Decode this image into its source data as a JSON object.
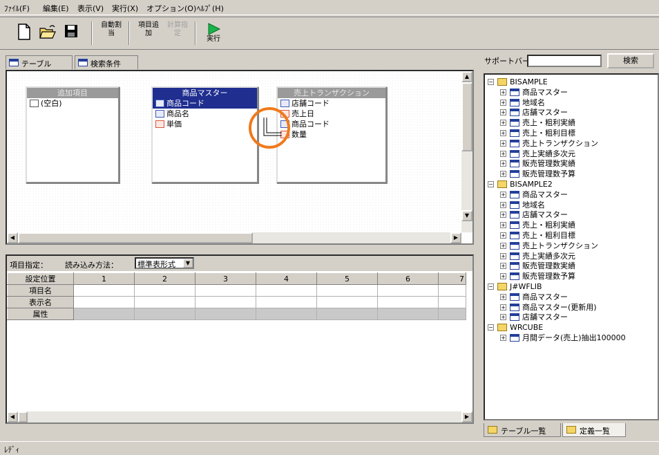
{
  "menu": [
    "ﾌｧｲﾙ(F)",
    "編集(E)",
    "表示(V)",
    "実行(X)",
    "オプション(O)",
    "ﾍﾙﾌﾟ(H)"
  ],
  "toolbar": {
    "new": "new-icon",
    "open": "open-icon",
    "save": "save-icon",
    "auto_assign_label": "自動割当",
    "add_item_label": "項目追加",
    "calc_spec_label": "計算指定",
    "run_label": "実行"
  },
  "tabs": [
    "テーブル",
    "検索条件"
  ],
  "designer": {
    "tables": [
      {
        "title": "追加項目",
        "active": false,
        "fields": [
          {
            "name": "(空白)",
            "icon": "empty"
          }
        ]
      },
      {
        "title": "商品マスター",
        "active": true,
        "fields": [
          {
            "name": "商品コード",
            "icon": "alpha",
            "selected": true
          },
          {
            "name": "商品名",
            "icon": "alpha",
            "selected": false
          },
          {
            "name": "単価",
            "icon": "number",
            "selected": false
          }
        ]
      },
      {
        "title": "売上トランザクション",
        "active": false,
        "fields": [
          {
            "name": "店舗コード",
            "icon": "alpha"
          },
          {
            "name": "売上日",
            "icon": "number"
          },
          {
            "name": "商品コード",
            "icon": "alpha"
          },
          {
            "name": "数量",
            "icon": "number"
          }
        ]
      }
    ],
    "highlight_color": "#f07a1c"
  },
  "grid": {
    "spec_label": "項目指定：",
    "load_method_label": "読み込み方法：",
    "load_method_value": "標準表形式",
    "row_headers": [
      "設定位置",
      "項目名",
      "表示名",
      "属性"
    ],
    "columns": [
      "1",
      "2",
      "3",
      "4",
      "5",
      "6",
      "7"
    ]
  },
  "status": "ﾚﾃﾞｨ",
  "support": {
    "label": "サポートバー",
    "search_button": "検索",
    "search_value": "",
    "tree": [
      {
        "label": "BISAMPLE",
        "level": 0,
        "type": "folder"
      },
      {
        "label": "商品マスター",
        "level": 1,
        "type": "table"
      },
      {
        "label": "地域名",
        "level": 1,
        "type": "table"
      },
      {
        "label": "店舗マスター",
        "level": 1,
        "type": "table"
      },
      {
        "label": "売上・粗利実績",
        "level": 1,
        "type": "table"
      },
      {
        "label": "売上・粗利目標",
        "level": 1,
        "type": "table"
      },
      {
        "label": "売上トランザクション",
        "level": 1,
        "type": "table"
      },
      {
        "label": "売上実績多次元",
        "level": 1,
        "type": "table"
      },
      {
        "label": "販売管理数実績",
        "level": 1,
        "type": "table"
      },
      {
        "label": "販売管理数予算",
        "level": 1,
        "type": "table"
      },
      {
        "label": "BISAMPLE2",
        "level": 0,
        "type": "folder"
      },
      {
        "label": "商品マスター",
        "level": 1,
        "type": "table"
      },
      {
        "label": "地域名",
        "level": 1,
        "type": "table"
      },
      {
        "label": "店舗マスター",
        "level": 1,
        "type": "table"
      },
      {
        "label": "売上・粗利実績",
        "level": 1,
        "type": "table"
      },
      {
        "label": "売上・粗利目標",
        "level": 1,
        "type": "table"
      },
      {
        "label": "売上トランザクション",
        "level": 1,
        "type": "table"
      },
      {
        "label": "売上実績多次元",
        "level": 1,
        "type": "table"
      },
      {
        "label": "販売管理数実績",
        "level": 1,
        "type": "table"
      },
      {
        "label": "販売管理数予算",
        "level": 1,
        "type": "table"
      },
      {
        "label": "J#WFLIB",
        "level": 0,
        "type": "folder"
      },
      {
        "label": "商品マスター",
        "level": 1,
        "type": "table"
      },
      {
        "label": "商品マスター(更新用)",
        "level": 1,
        "type": "table"
      },
      {
        "label": "店舗マスター",
        "level": 1,
        "type": "table"
      },
      {
        "label": "WRCUBE",
        "level": 0,
        "type": "folder"
      },
      {
        "label": "月間データ(売上)抽出100000",
        "level": 1,
        "type": "table"
      }
    ],
    "bottom_tabs": [
      "テーブル一覧",
      "定義一覧"
    ]
  }
}
